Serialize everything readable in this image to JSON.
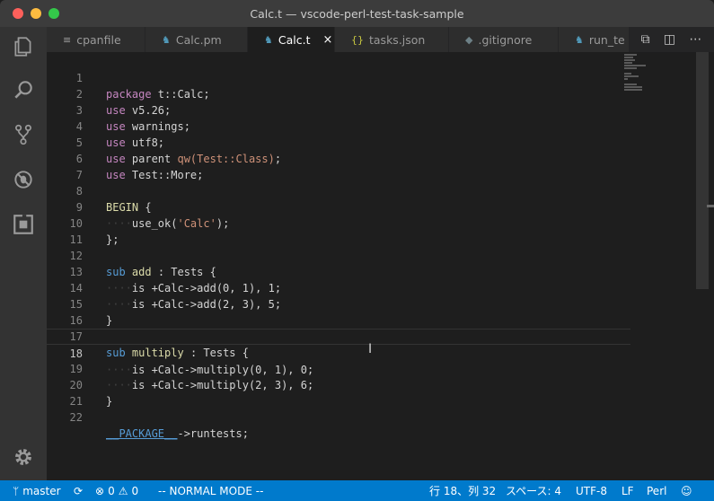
{
  "window": {
    "title": "Calc.t — vscode-perl-test-task-sample"
  },
  "tabs": [
    {
      "label": "cpanfile",
      "icon": "list-icon"
    },
    {
      "label": "Calc.pm",
      "icon": "camel-icon"
    },
    {
      "label": "Calc.t",
      "icon": "camel-icon",
      "active": true,
      "close": "×"
    },
    {
      "label": "tasks.json",
      "icon": "braces-icon",
      "glyph": "{}"
    },
    {
      "label": ".gitignore",
      "icon": "diamond-icon"
    },
    {
      "label": "run_te",
      "icon": "camel-icon"
    }
  ],
  "editor": {
    "line_numbers": [
      "1",
      "2",
      "3",
      "4",
      "5",
      "6",
      "7",
      "8",
      "9",
      "10",
      "11",
      "12",
      "13",
      "14",
      "15",
      "16",
      "17",
      "18",
      "19",
      "20",
      "21",
      "22"
    ],
    "code": {
      "l1a": "package",
      "l1b": " t::Calc;",
      "l2a": "use",
      "l2b": " v5.26;",
      "l3a": "use",
      "l3b": " warnings;",
      "l4a": "use",
      "l4b": " utf8;",
      "l5a": "use",
      "l5b": " parent ",
      "l5c": "qw(Test::Class)",
      "l5d": ";",
      "l6a": "use",
      "l6b": " Test::More;",
      "l8a": "BEGIN",
      "l8b": " {",
      "l9a": "····",
      "l9b": "use_ok(",
      "l9c": "'Calc'",
      "l9d": ");",
      "l10": "};",
      "l12a": "sub",
      "l12b": " add",
      "l12c": " : Tests {",
      "l13a": "····",
      "l13b": "is +Calc->add(0, 1), 1;",
      "l14a": "····",
      "l14b": "is +Calc->add(2, 3), 5;",
      "l15": "}",
      "l17a": "sub",
      "l17b": " multiply",
      "l17c": " : Tests {",
      "l18a": "····",
      "l18b": "is +Calc->multiply(0, 1), 0;",
      "l19a": "····",
      "l19b": "is +Calc->multiply(2, 3), 6;",
      "l20": "}",
      "l22a": "__PACKAGE__",
      "l22b": "->runtests;"
    }
  },
  "statusbar": {
    "branch": "master",
    "errors": "0",
    "warnings": "0",
    "mode": "-- NORMAL MODE --",
    "position": "行 18、列 32",
    "indent": "スペース: 4",
    "encoding": "UTF-8",
    "eol": "LF",
    "language": "Perl"
  },
  "colors": {
    "statusbar": "#007acc",
    "keyword": "#c586c0",
    "string": "#ce9178",
    "function": "#dcdcaa",
    "sub": "#569cd6"
  }
}
